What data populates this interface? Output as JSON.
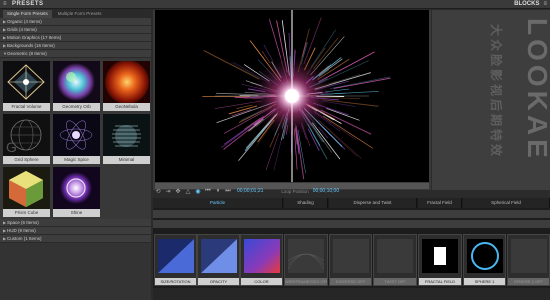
{
  "header": {
    "title": "PRESETS",
    "right": "BLOCKS",
    "menu_left": "≡",
    "menu_right": "≡"
  },
  "left_panel": {
    "subtabs": [
      "Single Form Presets",
      "Multiple Form Presets"
    ],
    "categories_top": [
      {
        "label": "Organic (4 Items)"
      },
      {
        "label": "Grids (4 Items)"
      },
      {
        "label": "Motion Graphics (17 Items)"
      },
      {
        "label": "Backgrounds (16 Items)"
      },
      {
        "label": "Geometric (8 Items)"
      }
    ],
    "presets": [
      {
        "label": "Fractal Volume",
        "thumb": "diamond"
      },
      {
        "label": "Geometry Orb",
        "thumb": "orb"
      },
      {
        "label": "GeoNebula",
        "thumb": "nebula"
      },
      {
        "label": "Grid Sphere",
        "thumb": "grid"
      },
      {
        "label": "Magic Spice",
        "thumb": "spice"
      },
      {
        "label": "Minimal",
        "thumb": "minimal"
      },
      {
        "label": "Prism Cube",
        "thumb": "cube"
      },
      {
        "label": "Shine",
        "thumb": "shine"
      }
    ],
    "categories_bottom": [
      {
        "label": "Space (6 Items)"
      },
      {
        "label": "HUD (9 Items)"
      },
      {
        "label": "Custom (1 Items)"
      }
    ]
  },
  "transport": {
    "timecode": "00;00;01;21",
    "loop_label": "Loop Position",
    "loop_tc": "00;00;10;00"
  },
  "watermark": {
    "text": "LOOKAE",
    "cn": "大众脸影视后期特效"
  },
  "modules": {
    "headers": [
      "Particle",
      "Shading",
      "Disperse and Twist",
      "Fractal Field",
      "Spherical Field"
    ],
    "slots": [
      {
        "label": "SIZE/ROTATION",
        "dim": false
      },
      {
        "label": "OPACITY",
        "dim": false
      },
      {
        "label": "COLOR",
        "dim": false
      },
      {
        "label": "WIREFRAME/GEO OFF",
        "dim": true
      },
      {
        "label": "DISPERSE OFF",
        "dim": true
      },
      {
        "label": "TWIST OFF",
        "dim": true
      },
      {
        "label": "FRACTAL FIELD",
        "dim": false
      },
      {
        "label": "SPHERE 1",
        "dim": false
      },
      {
        "label": "SPHERE 2 OFF",
        "dim": true
      }
    ]
  }
}
